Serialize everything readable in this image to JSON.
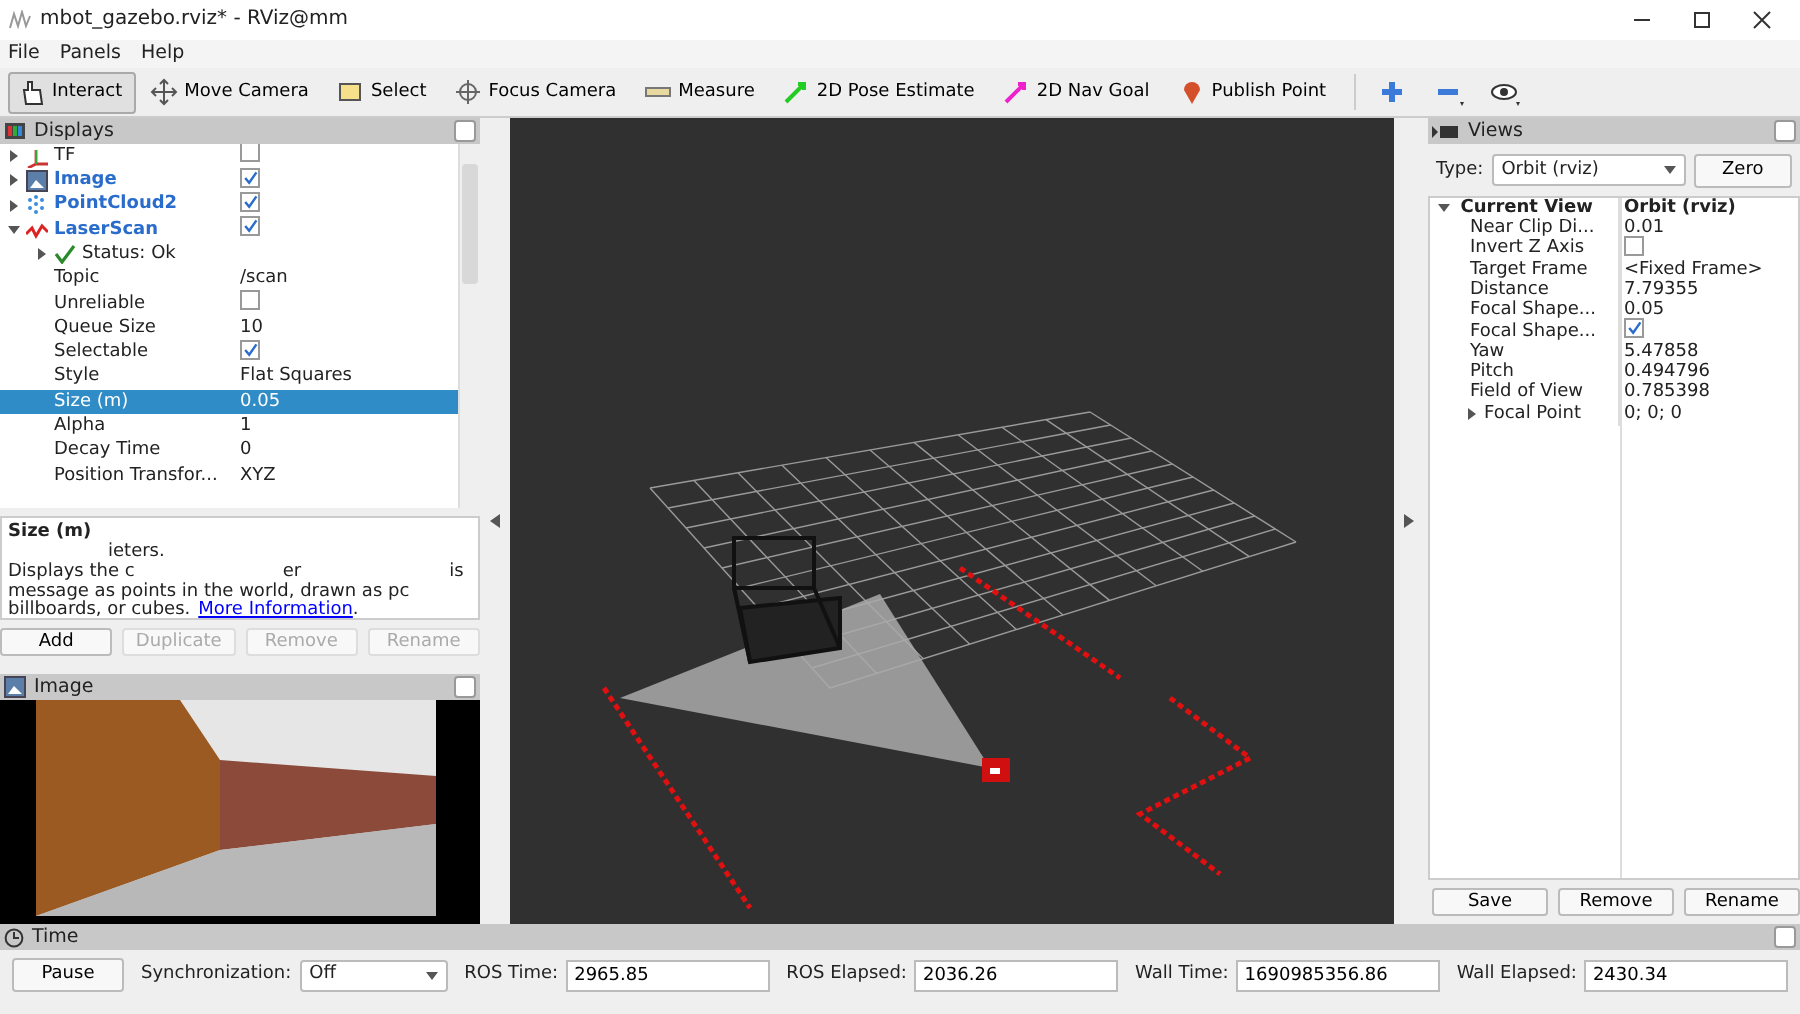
{
  "window": {
    "title": "mbot_gazebo.rviz* - RViz@mm"
  },
  "menu": [
    "File",
    "Panels",
    "Help"
  ],
  "toolbar": [
    {
      "label": "Interact",
      "selected": true
    },
    {
      "label": "Move Camera",
      "selected": false
    },
    {
      "label": "Select",
      "selected": false
    },
    {
      "label": "Focus Camera",
      "selected": false
    },
    {
      "label": "Measure",
      "selected": false
    },
    {
      "label": "2D Pose Estimate",
      "selected": false
    },
    {
      "label": "2D Nav Goal",
      "selected": false
    },
    {
      "label": "Publish Point",
      "selected": false
    }
  ],
  "displays": {
    "title": "Displays",
    "items": [
      {
        "label": "TF",
        "kind": "check",
        "checked": false,
        "expanded": false,
        "selected": false
      },
      {
        "label": "Image",
        "kind": "check",
        "checked": true,
        "expanded": false,
        "selected": false
      },
      {
        "label": "PointCloud2",
        "kind": "check",
        "checked": true,
        "expanded": false,
        "selected": false
      },
      {
        "label": "LaserScan",
        "kind": "check",
        "checked": true,
        "expanded": true,
        "selected": false,
        "children": [
          {
            "label": "Status: Ok",
            "kind": "status",
            "expanded": false,
            "selected": false
          },
          {
            "label": "Topic",
            "kind": "text",
            "value": "/scan",
            "selected": false
          },
          {
            "label": "Unreliable",
            "kind": "check",
            "checked": false,
            "selected": false
          },
          {
            "label": "Queue Size",
            "kind": "text",
            "value": "10",
            "selected": false
          },
          {
            "label": "Selectable",
            "kind": "check",
            "checked": true,
            "selected": false
          },
          {
            "label": "Style",
            "kind": "text",
            "value": "Flat Squares",
            "selected": false
          },
          {
            "label": "Size (m)",
            "kind": "text",
            "value": "0.05",
            "selected": true
          },
          {
            "label": "Alpha",
            "kind": "text",
            "value": "1",
            "selected": false
          },
          {
            "label": "Decay Time",
            "kind": "text",
            "value": "0",
            "selected": false
          },
          {
            "label": "Position Transfor...",
            "kind": "text",
            "value": "XYZ",
            "selected": false
          }
        ]
      }
    ]
  },
  "description": {
    "title": "Size (m)",
    "lines": [
      {
        "segments": [
          {
            "text": "ieters.",
            "kind": "text"
          }
        ]
      },
      {
        "segments": [
          {
            "text": "Displays the c",
            "kind": "text"
          },
          {
            "text": "er",
            "kind": "text"
          },
          {
            "text": "is",
            "kind": "text"
          }
        ]
      },
      {
        "segments": [
          {
            "text": "message as points in the world, drawn as pc",
            "kind": "text"
          }
        ]
      },
      {
        "segments": [
          {
            "text": "billboards, or cubes.",
            "kind": "text"
          },
          {
            "text": "More Information",
            "kind": "link"
          },
          {
            "text": ".",
            "kind": "text"
          }
        ]
      }
    ]
  },
  "display_buttons": [
    {
      "label": "Add",
      "disabled": false
    },
    {
      "label": "Duplicate",
      "disabled": true
    },
    {
      "label": "Remove",
      "disabled": true
    },
    {
      "label": "Rename",
      "disabled": true
    }
  ],
  "image_panel": {
    "title": "Image"
  },
  "views": {
    "title": "Views",
    "type_label": "Type:",
    "type_value": "Orbit (rviz)",
    "zero_button": "Zero",
    "tree": {
      "label": "Current View",
      "value": "Orbit (rviz)",
      "expanded": true,
      "children": [
        {
          "label": "Near Clip Di...",
          "kind": "text",
          "value": "0.01"
        },
        {
          "label": "Invert Z Axis",
          "kind": "check",
          "checked": false
        },
        {
          "label": "Target Frame",
          "kind": "text",
          "value": "<Fixed Frame>"
        },
        {
          "label": "Distance",
          "kind": "text",
          "value": "7.79355"
        },
        {
          "label": "Focal Shape...",
          "kind": "text",
          "value": "0.05"
        },
        {
          "label": "Focal Shape...",
          "kind": "check",
          "checked": true
        },
        {
          "label": "Yaw",
          "kind": "text",
          "value": "5.47858"
        },
        {
          "label": "Pitch",
          "kind": "text",
          "value": "0.494796"
        },
        {
          "label": "Field of View",
          "kind": "text",
          "value": "0.785398"
        },
        {
          "label": "Focal Point",
          "kind": "text",
          "value": "0; 0; 0",
          "expanded": false
        }
      ]
    },
    "buttons": [
      "Save",
      "Remove",
      "Rename"
    ]
  },
  "time": {
    "title": "Time",
    "pause_button": "Pause",
    "sync_label": "Synchronization:",
    "sync_value": "Off",
    "fields": [
      {
        "label": "ROS Time:",
        "value": "2965.85"
      },
      {
        "label": "ROS Elapsed:",
        "value": "2036.26"
      },
      {
        "label": "Wall Time:",
        "value": "1690985356.86"
      },
      {
        "label": "Wall Elapsed:",
        "value": "2430.34"
      }
    ]
  }
}
